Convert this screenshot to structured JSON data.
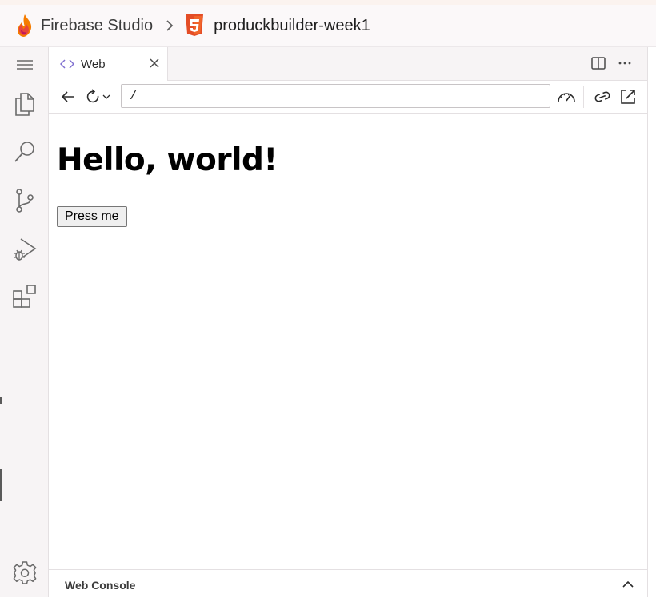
{
  "app": {
    "brand_name": "Firebase Studio",
    "project_name": "produckbuilder-week1",
    "accent_colors": {
      "firebase_orange": "#f57c00",
      "html5_orange": "#e44d26",
      "tab_icon": "#7f6fd0"
    }
  },
  "activity_bar": {
    "items": [
      {
        "icon": "menu-icon"
      },
      {
        "icon": "explorer-files-icon"
      },
      {
        "icon": "search-icon"
      },
      {
        "icon": "source-control-icon"
      },
      {
        "icon": "run-debug-icon"
      },
      {
        "icon": "extensions-icon"
      },
      {
        "icon": "settings-gear-icon"
      }
    ]
  },
  "tabs": [
    {
      "label": "Web",
      "icon": "code-brackets-icon",
      "active": true
    }
  ],
  "toolbar": {
    "url": "/",
    "icons": [
      "back-arrow-icon",
      "reload-icon",
      "chevron-down-icon",
      "performance-gauge-icon",
      "copy-link-icon",
      "open-external-icon"
    ]
  },
  "preview": {
    "heading": "Hello, world!",
    "button_label": "Press me"
  },
  "console": {
    "title": "Web Console"
  }
}
